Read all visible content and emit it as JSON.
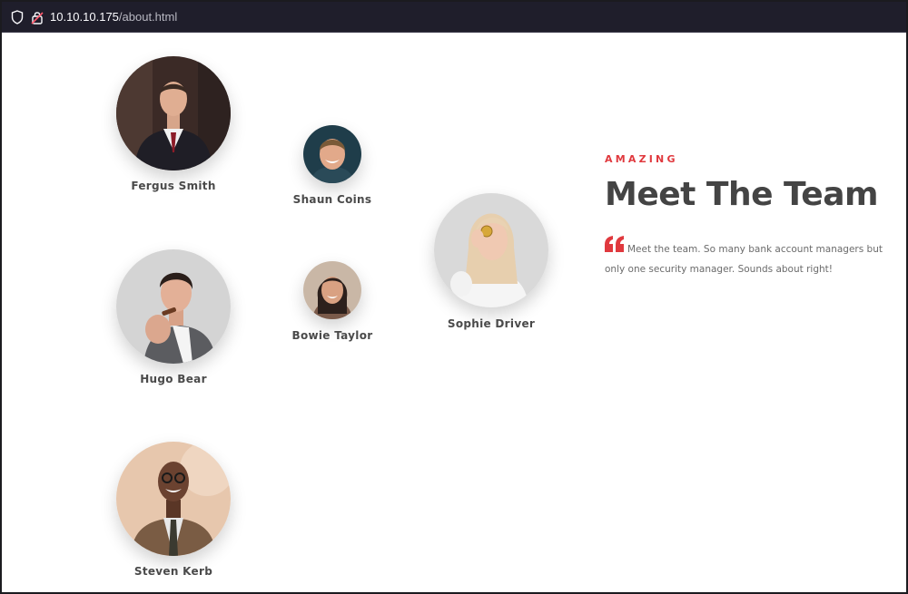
{
  "browser": {
    "url_host": "10.10.10.175",
    "url_path": "/about.html",
    "icons": [
      "shield-icon",
      "insecure-lock-icon"
    ]
  },
  "section": {
    "eyebrow": "AMAZING",
    "title": "Meet The Team",
    "quote_icon": "quote-icon",
    "description": "Meet the team. So many bank account managers but only one security manager. Sounds about right!",
    "accent_color": "#e0393e"
  },
  "team": [
    {
      "name": "Fergus Smith"
    },
    {
      "name": "Shaun Coins"
    },
    {
      "name": "Hugo Bear"
    },
    {
      "name": "Bowie Taylor"
    },
    {
      "name": "Sophie Driver"
    },
    {
      "name": "Steven Kerb"
    }
  ]
}
